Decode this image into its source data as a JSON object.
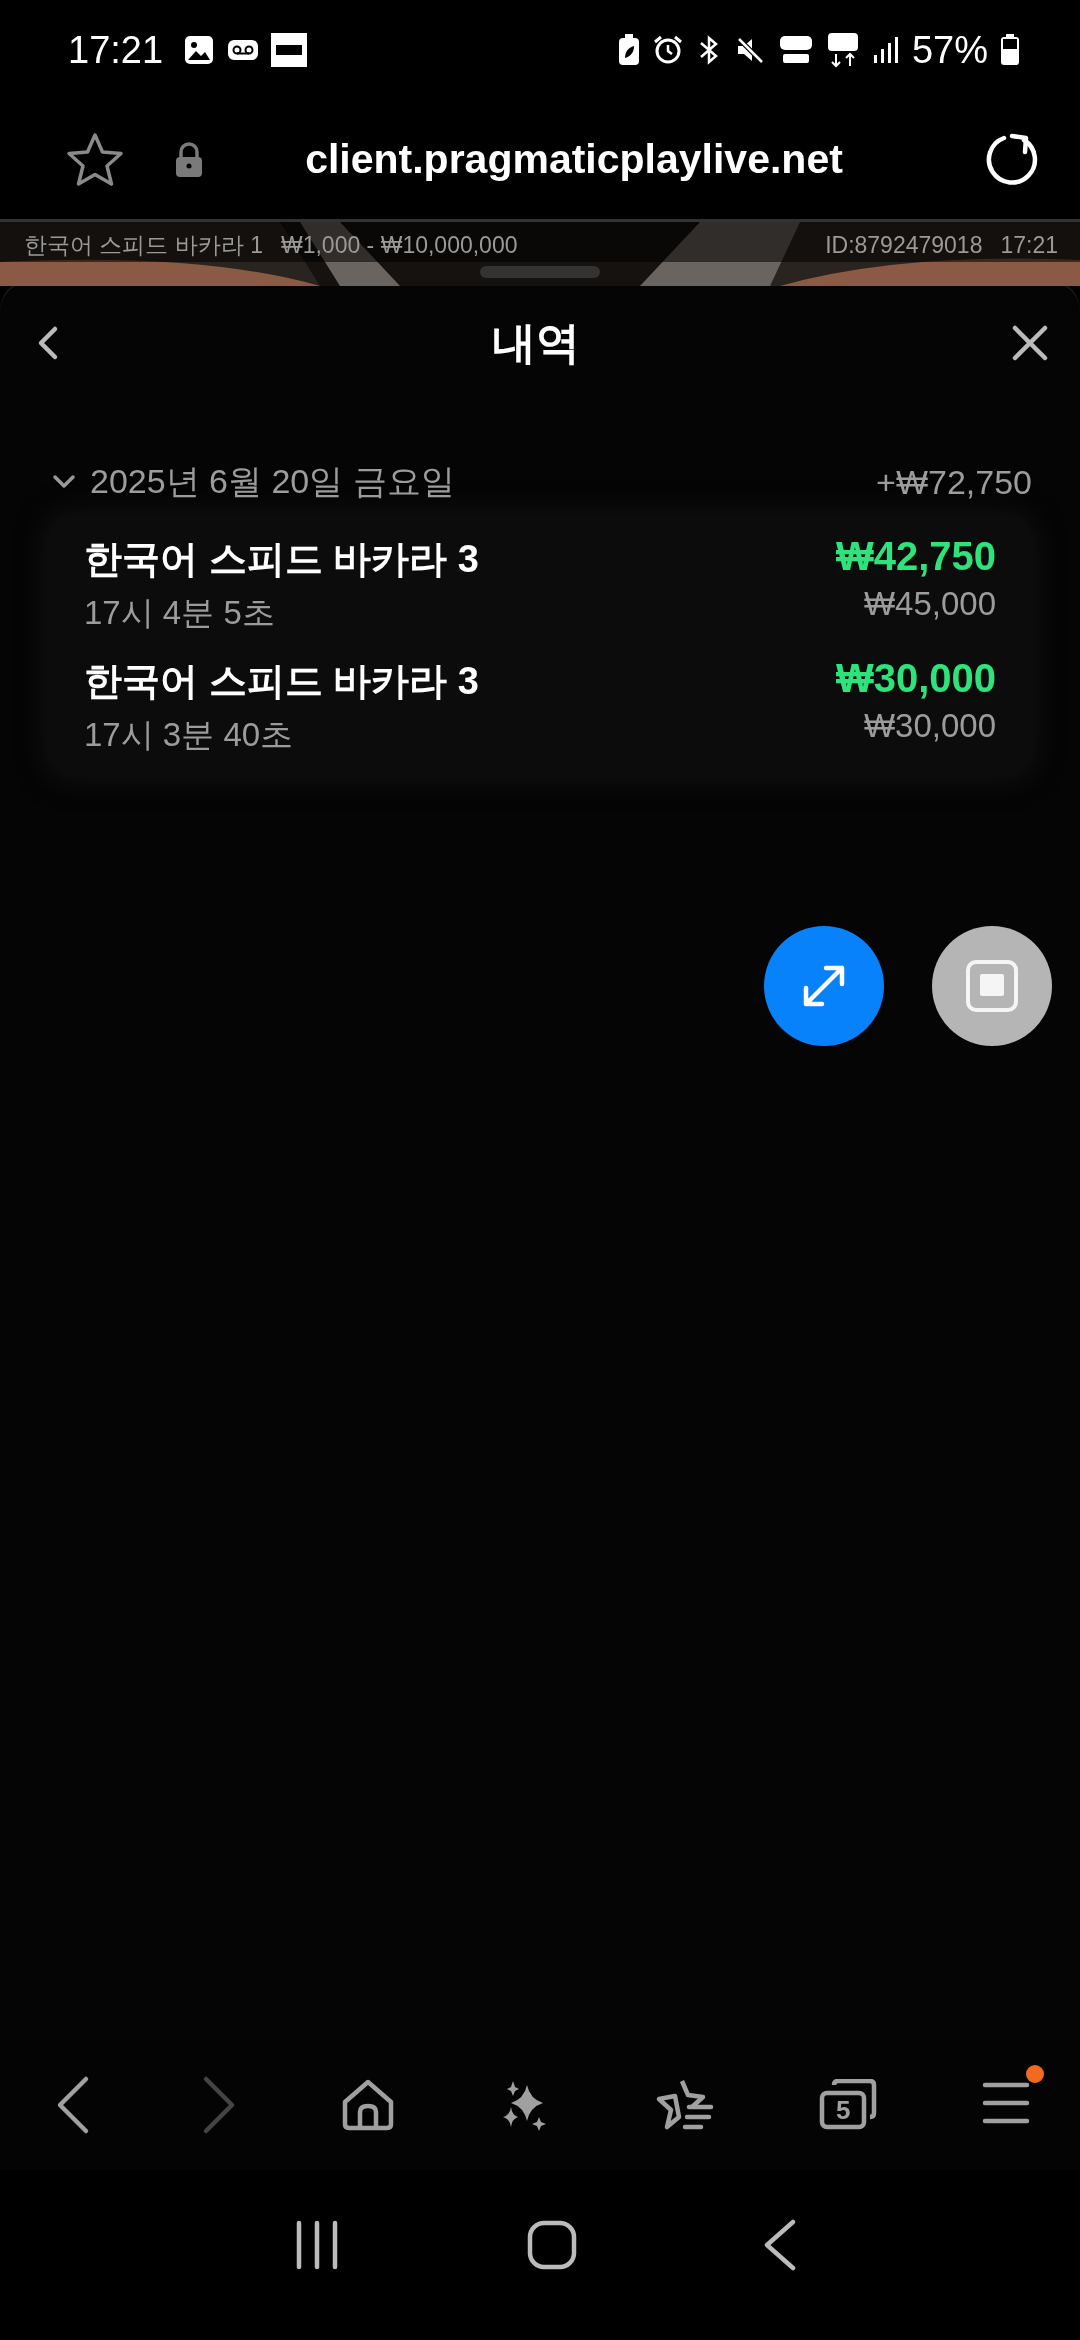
{
  "status_bar": {
    "time": "17:21",
    "battery": "57%"
  },
  "browser": {
    "url": "client.pragmaticplaylive.net"
  },
  "game_bar": {
    "table": "한국어 스피드 바카라 1",
    "limits": "₩1,000 - ₩10,000,000",
    "id": "ID:8792479018",
    "time": "17:21"
  },
  "panel": {
    "title": "내역",
    "groups": [
      {
        "date": "2025년 6월 20일 금요일",
        "total": "+₩72,750",
        "expanded": true,
        "items": [
          {
            "name": "한국어 스피드 바카라 3",
            "time": "17시 4분 5초",
            "payout": "₩42,750",
            "bet": "₩45,000"
          },
          {
            "name": "한국어 스피드 바카라 3",
            "time": "17시 3분 40초",
            "payout": "₩30,000",
            "bet": "₩30,000"
          }
        ]
      }
    ]
  },
  "bottom_nav": {
    "back_disabled": false,
    "forward_disabled": true,
    "tab_count": "5",
    "menu_badge": true
  }
}
